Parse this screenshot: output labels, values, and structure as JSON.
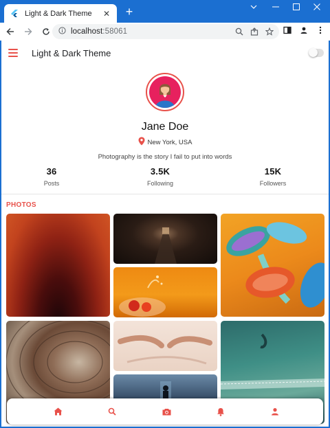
{
  "browser": {
    "tab_title": "Light & Dark Theme",
    "tab_close": "✕",
    "new_tab": "+",
    "url_host": "localhost",
    "url_port": ":58061"
  },
  "app": {
    "title": "Light & Dark Theme",
    "theme_toggle_on": false
  },
  "profile": {
    "name": "Jane Doe",
    "location": "New York, USA",
    "bio": "Photography is the story I fail to put into words",
    "stats": [
      {
        "value": "36",
        "label": "Posts"
      },
      {
        "value": "3.5K",
        "label": "Following"
      },
      {
        "value": "15K",
        "label": "Followers"
      }
    ]
  },
  "photos": {
    "section_title": "PHOTOS",
    "items": [
      "sunset-orange",
      "dark-tunnel",
      "colorful-mushrooms",
      "fruit-splash",
      "wood-rings",
      "hands-fabric",
      "teal-aerial-coast",
      "dark-corridor-figure"
    ]
  },
  "bottom_nav": {
    "items": [
      "home-icon",
      "search-icon",
      "camera-icon",
      "bell-icon",
      "person-icon"
    ]
  },
  "colors": {
    "accent": "#e8514a",
    "browser_frame": "#1b6fd1",
    "avatar_bg": "#e7215e"
  }
}
